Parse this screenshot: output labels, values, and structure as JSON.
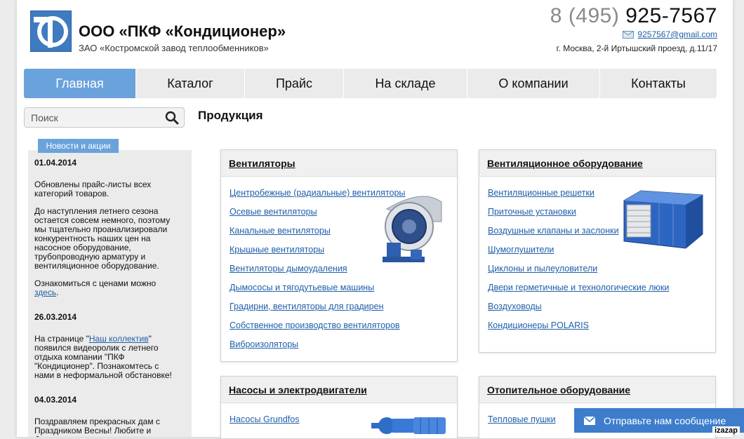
{
  "header": {
    "company_name": "ООО «ПКФ «Кондиционер»",
    "company_sub": "ЗАО «Костромской завод теплообменников»",
    "phone_code": "8 (495)",
    "phone_number": "925-7567",
    "email": "9257567@gmail.com",
    "address": "г. Москва, 2-й Иртышский проезд, д.11/17"
  },
  "nav": [
    {
      "label": "Главная",
      "active": true
    },
    {
      "label": "Каталог"
    },
    {
      "label": "Прайс"
    },
    {
      "label": "На складе"
    },
    {
      "label": "О компании"
    },
    {
      "label": "Контакты"
    }
  ],
  "search": {
    "placeholder": "Поиск"
  },
  "news": {
    "tab_label": "Новости и акции",
    "items": [
      {
        "date": "01.04.2014",
        "p1": "Обновлены прайс-листы всех категорий товаров.",
        "p2": "До наступления летнего сезона остается совсем немного, поэтому мы тщательно проанализировали конкурентность наших цен на насосное оборудование, трубопроводную арматуру и вентиляционное оборудование.",
        "p3_text": "Ознакомиться с ценами можно ",
        "p3_link": "здесь",
        "p3_end": "."
      },
      {
        "date": "26.03.2014",
        "p1_start": "На странице \"",
        "p1_link": "Наш коллектив",
        "p1_end": "\" появился видеоролик с летнего отдыха компании \"ПКФ \"Кондиционер\". Познакомтесь с нами в неформальной обстановке!"
      },
      {
        "date": "04.03.2014",
        "p1": "Поздравляем прекрасных дам с Праздником Весны! Любите и будьте"
      }
    ]
  },
  "content": {
    "title": "Продукция",
    "cards": [
      {
        "title": "Вентиляторы",
        "links": [
          "Центробежные (радиальные) вентиляторы",
          "Осевые вентиляторы",
          "Канальные вентиляторы",
          "Крышные вентиляторы",
          "Вентиляторы дымоудаления",
          "Дымососы и тягодутьевые машины",
          "Градирни, вентиляторы для градирен",
          "Собственное производство вентиляторов",
          "Виброизоляторы"
        ]
      },
      {
        "title": "Вентиляционное оборудование",
        "links": [
          "Вентиляционные решетки",
          "Приточные установки",
          "Воздушные клапаны и заслонки",
          "Шумоглушители",
          "Циклоны и пылеуловители",
          "Двери герметичные и технологические люки",
          "Воздуховоды",
          "Кондиционеры POLARIS"
        ]
      },
      {
        "title": "Насосы и электродвигатели",
        "links": [
          "Насосы Grundfos"
        ]
      },
      {
        "title": "Отопительное оборудование",
        "links": [
          "Тепловые пушки"
        ]
      }
    ]
  },
  "message_button": {
    "label": "Отправьте нам сообщение"
  },
  "watermark": "izazap",
  "colors": {
    "accent": "#6aa2dc",
    "link": "#1f5fa8",
    "button": "#3d7dcc"
  }
}
